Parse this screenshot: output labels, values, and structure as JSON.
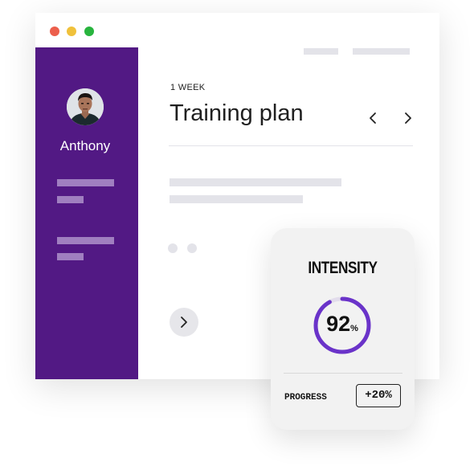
{
  "window": {
    "controls": [
      {
        "name": "close",
        "color": "#ec5f4c"
      },
      {
        "name": "minimize",
        "color": "#f0c13b"
      },
      {
        "name": "maximize",
        "color": "#28b43e"
      }
    ]
  },
  "sidebar": {
    "color": "#521984",
    "user_name": "Anthony",
    "avatar": "user-avatar-photo"
  },
  "main": {
    "period": "1 WEEK",
    "title": "Training plan",
    "prev_icon": "chevron-left-icon",
    "next_icon": "chevron-right-icon",
    "forward_icon": "chevron-right-icon"
  },
  "card": {
    "title": "INTENSITY",
    "intensity_value": "92",
    "intensity_unit": "%",
    "intensity_fraction": 0.92,
    "ring_color": "#6a33c9",
    "ring_track_color": "#e2dcec",
    "progress_label": "PROGRESS",
    "progress_value": "+20%"
  }
}
